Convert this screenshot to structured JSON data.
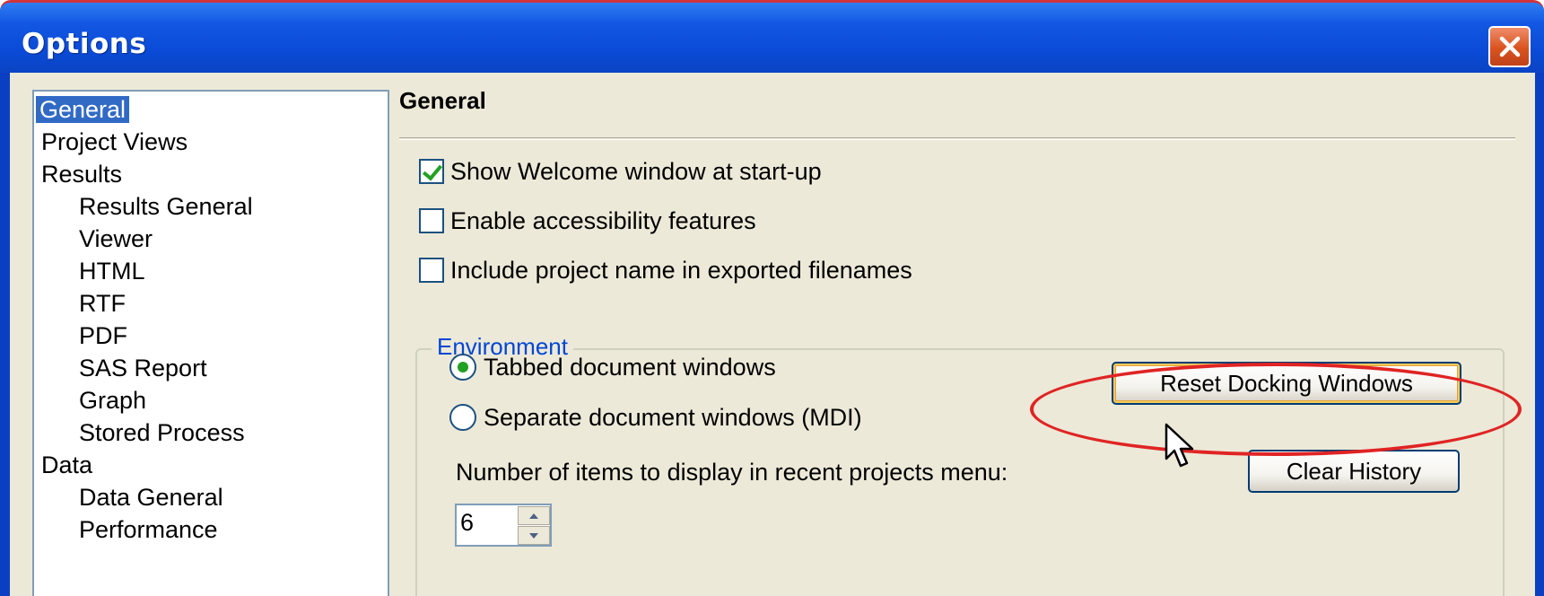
{
  "window": {
    "title": "Options",
    "close_glyph": "✕"
  },
  "sidebar": {
    "items": [
      {
        "label": "General",
        "indent": 0,
        "selected": true
      },
      {
        "label": "Project Views",
        "indent": 0
      },
      {
        "label": "Results",
        "indent": 0
      },
      {
        "label": "Results General",
        "indent": 1
      },
      {
        "label": "Viewer",
        "indent": 1
      },
      {
        "label": "HTML",
        "indent": 1
      },
      {
        "label": "RTF",
        "indent": 1
      },
      {
        "label": "PDF",
        "indent": 1
      },
      {
        "label": "SAS Report",
        "indent": 1
      },
      {
        "label": "Graph",
        "indent": 1
      },
      {
        "label": "Stored Process",
        "indent": 1
      },
      {
        "label": "Data",
        "indent": 0
      },
      {
        "label": "Data General",
        "indent": 1
      },
      {
        "label": "Performance",
        "indent": 1
      }
    ]
  },
  "panel": {
    "heading": "General",
    "checkboxes": [
      {
        "label": "Show Welcome window at start-up",
        "checked": true
      },
      {
        "label": "Enable accessibility features",
        "checked": false
      },
      {
        "label": "Include project name in exported filenames",
        "checked": false
      }
    ],
    "environment": {
      "label": "Environment",
      "radios": [
        {
          "label": "Tabbed document windows",
          "checked": true
        },
        {
          "label": "Separate document windows (MDI)",
          "checked": false
        }
      ],
      "reset_button": "Reset Docking Windows",
      "clear_button": "Clear History",
      "recent_label": "Number of items to display in recent projects menu:",
      "recent_value": "6"
    }
  },
  "colors": {
    "title_bar": "#0a4ad6",
    "selection": "#316ac5",
    "highlight_ellipse": "#e02424",
    "group_label": "#0046d5"
  }
}
